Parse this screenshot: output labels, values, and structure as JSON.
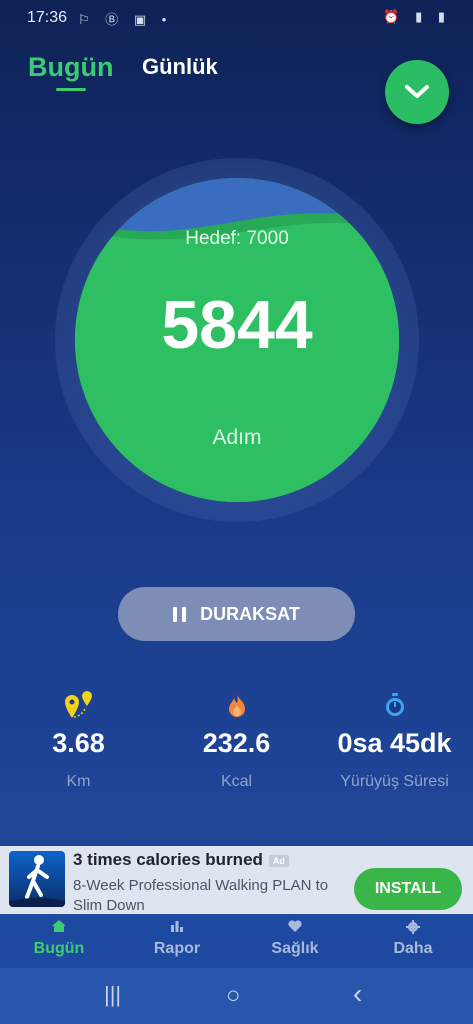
{
  "status_bar": {
    "time": "17:36",
    "left_icons": "⚐ Ⓑ ▣ •",
    "right_icons": "⏰ ▮ ▮"
  },
  "header": {
    "tabs": [
      {
        "label": "Bugün",
        "active": true
      },
      {
        "label": "Günlük",
        "active": false
      }
    ]
  },
  "progress": {
    "goal_label": "Hedef: 7000",
    "steps": "5844",
    "unit": "Adım",
    "fraction": 0.835,
    "colors": {
      "fill": "#2fbf63",
      "wave": "#27a957"
    }
  },
  "pause_button": {
    "label": "DURAKSAT",
    "icon": "pause-icon"
  },
  "stats": [
    {
      "icon": "location-pin-icon",
      "value": "3.68",
      "label": "Km",
      "color": "#f3d21a"
    },
    {
      "icon": "flame-icon",
      "value": "232.6",
      "label": "Kcal",
      "color": "#f0883c"
    },
    {
      "icon": "stopwatch-icon",
      "value": "0sa 45dk",
      "label": "Yürüyüş Süresi",
      "color": "#3aa6f0"
    }
  ],
  "ad": {
    "title": "3 times calories burned",
    "badge": "Ad",
    "description": "8-Week Professional Walking PLAN to Slim Down",
    "button_label": "INSTALL"
  },
  "bottom_nav": {
    "items": [
      {
        "label": "Bugün",
        "icon": "home-icon",
        "active": true
      },
      {
        "label": "Rapor",
        "icon": "bar-chart-icon",
        "active": false
      },
      {
        "label": "Sağlık",
        "icon": "heart-icon",
        "active": false
      },
      {
        "label": "Daha",
        "icon": "gear-icon",
        "active": false
      }
    ]
  },
  "system_nav": {
    "recents": "|||",
    "home": "○",
    "back": "‹"
  }
}
